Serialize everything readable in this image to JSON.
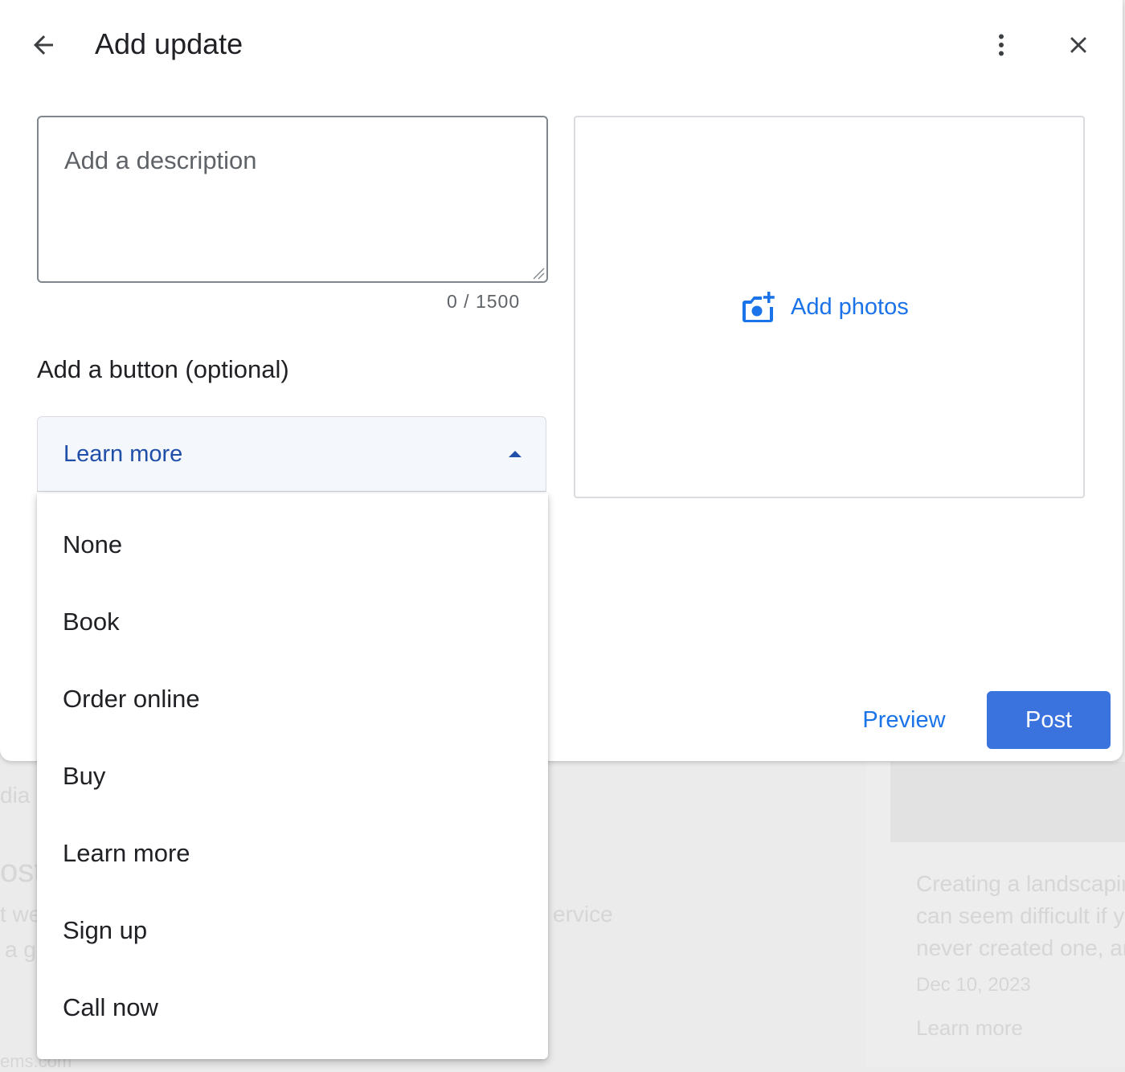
{
  "dialog": {
    "title": "Add update",
    "description_placeholder": "Add a description",
    "char_counter": "0 / 1500",
    "button_section_label": "Add a button (optional)",
    "selected_button": "Learn more",
    "add_photos_label": "Add photos",
    "preview_label": "Preview",
    "post_label": "Post"
  },
  "menu": {
    "options": [
      "None",
      "Book",
      "Order online",
      "Buy",
      "Learn more",
      "Sign up",
      "Call now"
    ]
  },
  "background": {
    "frag_dia": "dia",
    "frag_ost": "ost",
    "frag_we": "t we",
    "frag_ag": "a g",
    "frag_ervice": "ervice",
    "frag_bottom": "ems.com",
    "card_line1": "Creating a landscapin",
    "card_line2": "can seem difficult if y",
    "card_line3": "never created one, an",
    "card_date": "Dec 10, 2023",
    "card_link": "Learn more"
  },
  "colors": {
    "accent": "#1a73e8",
    "primary_button": "#3a72de",
    "select_text": "#1f4fa8",
    "select_bg": "#f4f7fc"
  },
  "icons": {
    "back": "arrow-back-icon",
    "more": "more-vert-icon",
    "close": "close-icon",
    "camera": "add-photo-icon"
  }
}
